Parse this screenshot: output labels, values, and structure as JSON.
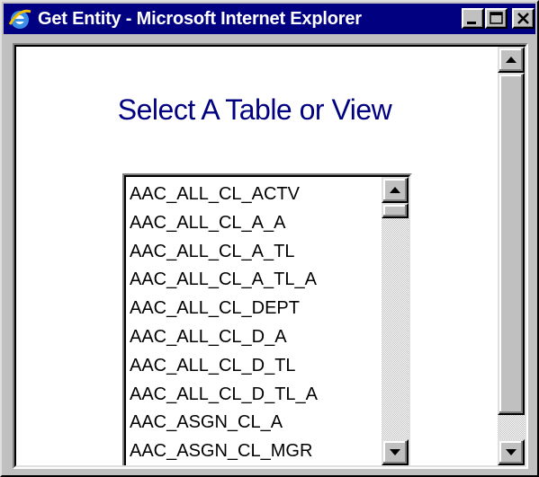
{
  "window": {
    "title": "Get Entity - Microsoft Internet Explorer",
    "titlebar_color": "#000080",
    "title_icon": "ie-icon"
  },
  "page": {
    "heading": "Select A Table or View",
    "heading_color": "#000080"
  },
  "list": {
    "items": [
      "AAC_ALL_CL_ACTV",
      "AAC_ALL_CL_A_A",
      "AAC_ALL_CL_A_TL",
      "AAC_ALL_CL_A_TL_A",
      "AAC_ALL_CL_DEPT",
      "AAC_ALL_CL_D_A",
      "AAC_ALL_CL_D_TL",
      "AAC_ALL_CL_D_TL_A",
      "AAC_ASGN_CL_A",
      "AAC_ASGN_CL_MGR"
    ]
  }
}
